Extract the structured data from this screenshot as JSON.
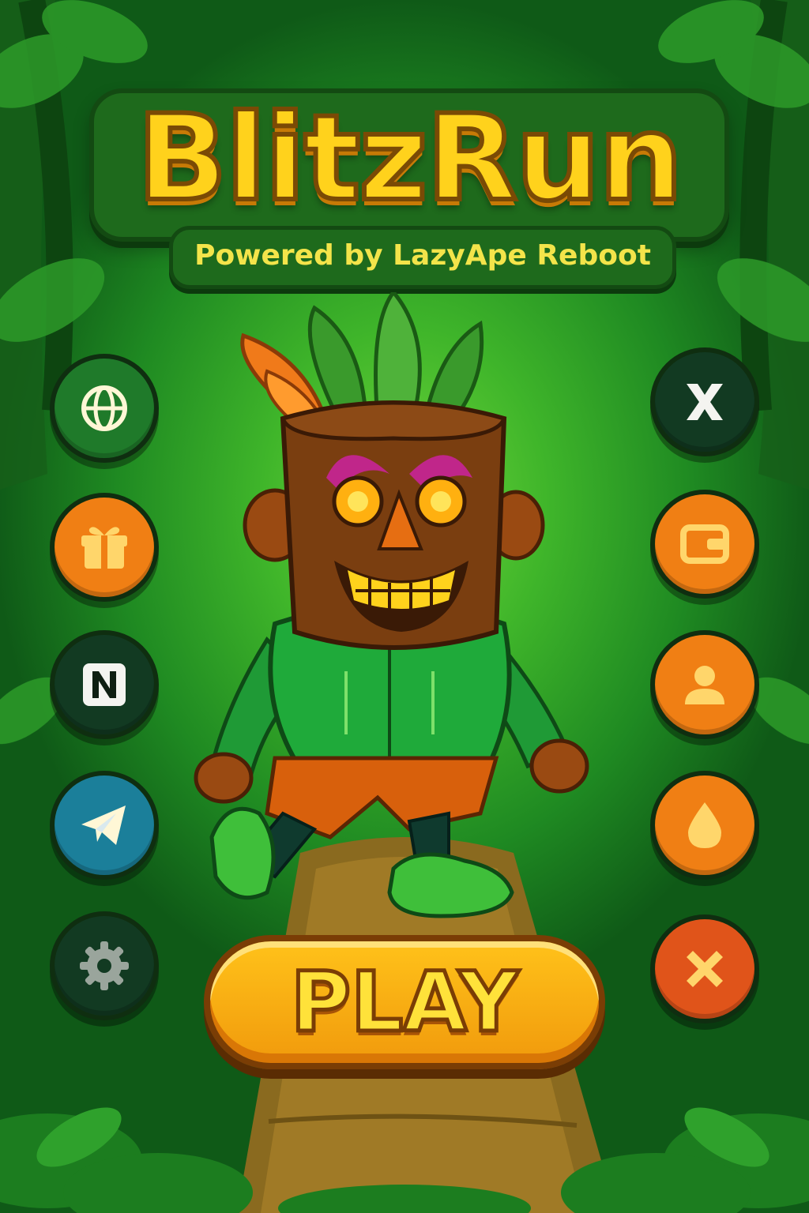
{
  "game": {
    "title": "BlitzRun",
    "subtitle": "Powered by LazyApe Reboot",
    "play_label": "PLAY"
  },
  "left_buttons": [
    {
      "icon": "globe-icon",
      "color": "#1f7a2a"
    },
    {
      "icon": "gift-icon",
      "color": "#f07f14"
    },
    {
      "icon": "n-logo-icon",
      "color": "#123a22"
    },
    {
      "icon": "telegram-icon",
      "color": "#1b7f9a"
    },
    {
      "icon": "gear-icon",
      "color": "#123a22"
    }
  ],
  "right_buttons": [
    {
      "icon": "x-logo-icon",
      "color": "#123a22"
    },
    {
      "icon": "wallet-icon",
      "color": "#f07f14"
    },
    {
      "icon": "user-icon",
      "color": "#f07f14"
    },
    {
      "icon": "drop-icon",
      "color": "#f07f14"
    },
    {
      "icon": "close-icon",
      "color": "#e0541a"
    }
  ],
  "colors": {
    "title_yellow": "#ffd21c",
    "panel_green": "#1e6a1c",
    "play_orange": "#f19a0c"
  }
}
